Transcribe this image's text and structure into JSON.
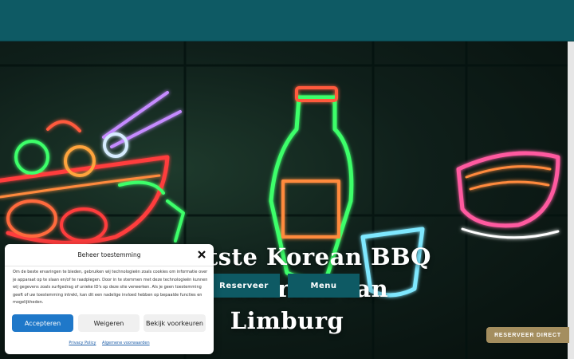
{
  "hero": {
    "title_line1": "Grootste Korean BBQ",
    "title_line2": "Restaurant van Limburg",
    "buttons": {
      "reserveer": "Reserveer",
      "menu": "Menu"
    }
  },
  "cookie_banner": {
    "title": "Beheer toestemming",
    "text": "Om de beste ervaringen te bieden, gebruiken wij technologieën zoals cookies om informatie over je apparaat op te slaan en/of te raadplegen. Door in te stemmen met deze technologieën kunnen wij gegevens zoals surfgedrag of unieke ID's op deze site verwerken. Als je geen toestemming geeft of uw toestemming intrekt, kan dit een nadelige invloed hebben op bepaalde functies en mogelijkheden.",
    "accept": "Accepteren",
    "reject": "Weigeren",
    "preferences": "Bekijk voorkeuren",
    "links": {
      "privacy": "Privacy Policy",
      "terms": "Algemene voorwaarden"
    }
  },
  "floating_button": "RESERVEER DIRECT",
  "colors": {
    "primary": "#0e5a64",
    "accent_blue": "#1f78c9",
    "gold": "#a48e5f"
  }
}
